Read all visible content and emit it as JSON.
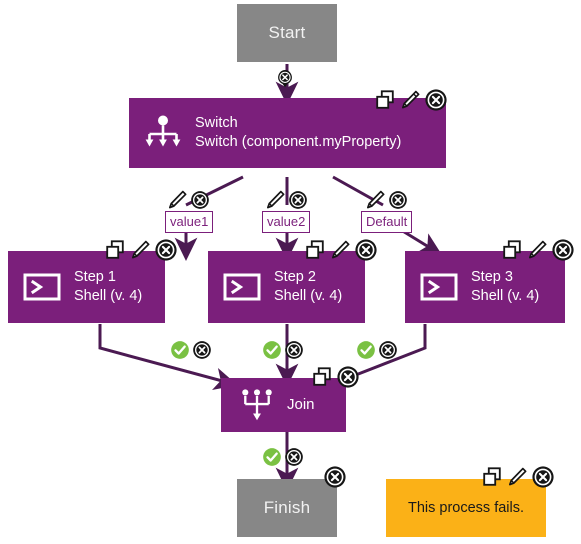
{
  "diagram": {
    "title": "Process flow with Switch branching and Join",
    "colors": {
      "task": "#7B1F7B",
      "terminal": "#878787",
      "note": "#FBB117",
      "edge": "#4B1A52",
      "chip_border": "#7B1F7B",
      "chip_text": "#7B1F7B",
      "success": "#7AC143",
      "delete": "#161616",
      "canvas": "#FFFFFF"
    }
  },
  "nodes": {
    "start": {
      "label": "Start",
      "kind": "terminal",
      "icon": "none"
    },
    "switch": {
      "title": "Switch",
      "subtitle": "Switch (component.myProperty)",
      "kind": "task",
      "icon": "switch-branch-icon"
    },
    "step1": {
      "title": "Step 1",
      "subtitle": "Shell (v. 4)",
      "kind": "task",
      "icon": "shell-terminal-icon"
    },
    "step2": {
      "title": "Step 2",
      "subtitle": "Shell (v. 4)",
      "kind": "task",
      "icon": "shell-terminal-icon"
    },
    "step3": {
      "title": "Step 3",
      "subtitle": "Shell (v. 4)",
      "kind": "task",
      "icon": "shell-terminal-icon"
    },
    "join": {
      "title": "Join",
      "kind": "task",
      "icon": "join-merge-icon"
    },
    "finish": {
      "label": "Finish",
      "kind": "terminal",
      "icon": "none"
    },
    "note": {
      "text": "This process fails.",
      "kind": "note"
    }
  },
  "branches": {
    "value1": "value1",
    "value2": "value2",
    "default": "Default"
  },
  "icon_names": {
    "copy": "copy-icon",
    "pencil": "edit-pencil-icon",
    "delete": "delete-circle-x-icon",
    "success": "success-check-circle-icon"
  }
}
